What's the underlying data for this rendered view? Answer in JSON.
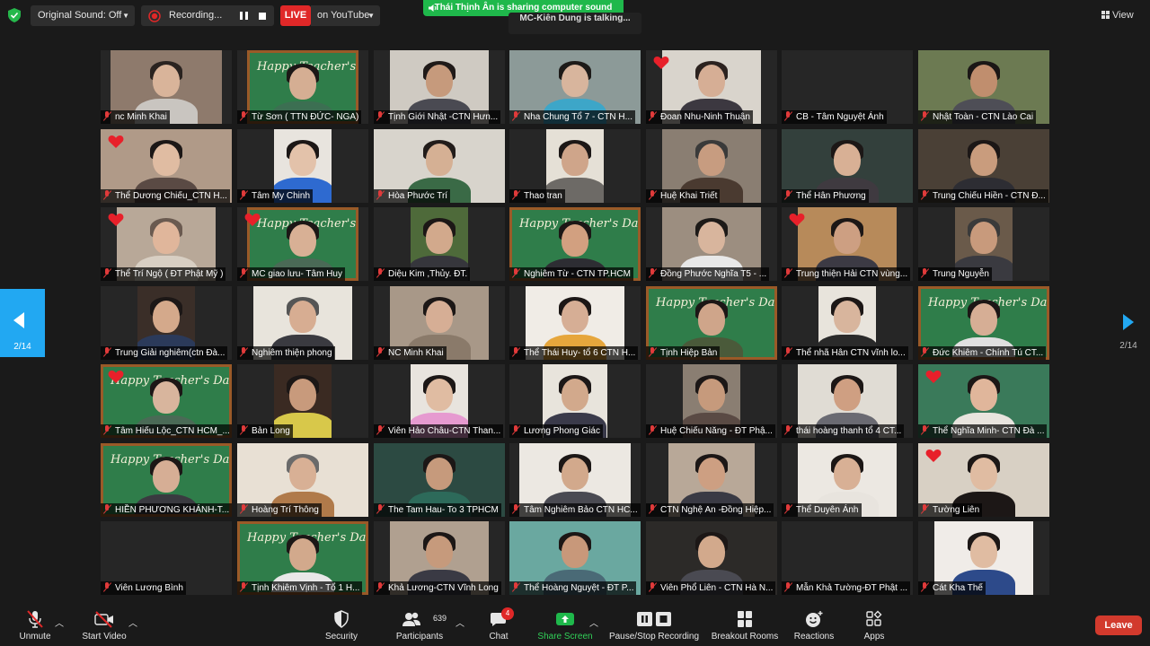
{
  "topbar": {
    "sound_label": "Original Sound: Off",
    "recording_label": "Recording...",
    "live_label": "LIVE",
    "youtube_label": "on YouTube",
    "share_banner": "Thái Thịnh Ân is sharing computer sound",
    "talking": "MC-Kiên Dung is talking...",
    "view_label": "View"
  },
  "pager": {
    "prev_page": "2/14",
    "next_page": "2/14"
  },
  "participants": [
    "nc Minh Khai",
    "Từ Sơn ( TTN ĐỨC- NGA)",
    "Tịnh Giới Nhật -CTN Hưn...",
    "Nha Chung Tổ 7 - CTN H...",
    "Đoan Nhu-Ninh Thuận",
    "CB - Tâm Nguyệt Ánh",
    "Nhật Toàn - CTN Lào Cai",
    "Thể Dương Chiếu_CTN H...",
    "Tâm My Chinh",
    "Hòa Phước Trí",
    "Thao tran",
    "Huệ Khai Triết",
    "Thể Hân Phương",
    "Trung Chiếu Hiền - CTN Đ...",
    "Thể Trí Ngộ ( ĐT Phật Mỹ )",
    "MC giao lưu- Tâm Huy",
    "Diệu Kim ,Thủy. ĐT.",
    "Nghiêm Từ - CTN TP.HCM",
    "Đồng Phước Nghĩa T5 - ...",
    "Trung thiện Hải CTN vùng...",
    "Trung Nguyễn",
    "Trung Giải nghiêm(ctn Đà...",
    "Nghiêm thiện phong",
    "NC Minh Khai",
    "Thể Thái Huy- tổ 6 CTN H...",
    "Tịnh Hiệp Bản",
    "Thể nhã Hân CTN vĩnh lo...",
    "Đức Khiêm - Chính Tú CT...",
    "Tâm Hiếu Lộc_CTN HCM_...",
    "Bản Long",
    "Viên Hảo Châu-CTN Than...",
    "Lương Phong Giác",
    "Huệ Chiếu Năng - ĐT Phậ...",
    "thái hoàng thanh tổ 4 CT...",
    "Thể Nghĩa Minh- CTN Đà ...",
    "HIỀN PHƯƠNG KHÁNH-T...",
    "Hoàng Trí Thông",
    "The Tam Hau- To 3 TPHCM",
    "Tâm Nghiêm Bảo CTN HC...",
    "CTN Nghệ An -Đồng Hiệp...",
    "Thể Duyên Ánh",
    "Tường Liên",
    "Viên Lương Bình",
    "Tịnh Khiêm Vịnh - Tổ 1 H...",
    "Khả Lương-CTN Vĩnh Long",
    "Thể Hoàng Nguyệt - ĐT P...",
    "Viên Phổ Liên - CTN Hà N...",
    "Mẫn Khả Tường-ĐT Phật ...",
    "Cát Kha Thế"
  ],
  "teacher_day_text": "Happy Teacher's Day",
  "toolbar": {
    "unmute": "Unmute",
    "start_video": "Start Video",
    "security": "Security",
    "participants": "Participants",
    "participants_count": "639",
    "chat": "Chat",
    "chat_badge": "4",
    "share_screen": "Share Screen",
    "record": "Pause/Stop Recording",
    "breakout": "Breakout Rooms",
    "reactions": "Reactions",
    "apps": "Apps",
    "leave": "Leave"
  },
  "colors": {
    "accent": "#22a8f2",
    "live": "#e02828",
    "share": "#1fb84b",
    "leave": "#d23a2d",
    "heart": "#e8202a"
  }
}
